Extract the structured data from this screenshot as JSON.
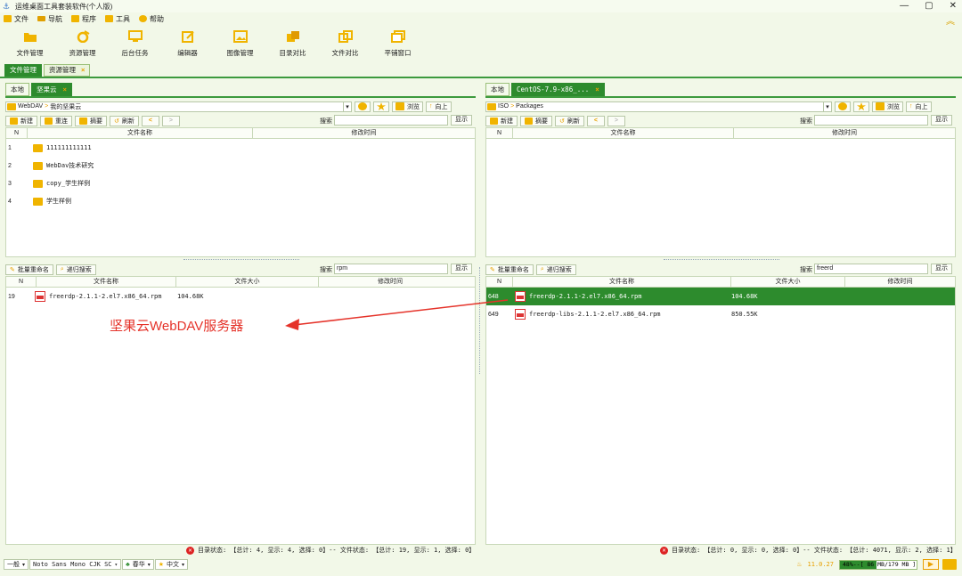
{
  "window": {
    "title": "运维桌面工具套装软件(个人版)",
    "controls": [
      "—",
      "▢",
      "✕"
    ]
  },
  "menu": [
    {
      "label": "文件",
      "color": "#f0b400"
    },
    {
      "label": "导航",
      "color": "#f0b400"
    },
    {
      "label": "程序",
      "color": "#f0b400"
    },
    {
      "label": "工具",
      "color": "#f0b400"
    },
    {
      "label": "帮助",
      "color": "#f0b400"
    }
  ],
  "toolbar": [
    {
      "label": "文件管理",
      "icon": "folder-open-icon"
    },
    {
      "label": "资源管理",
      "icon": "resources-icon"
    },
    {
      "label": "后台任务",
      "icon": "monitor-icon"
    },
    {
      "label": "编辑器",
      "icon": "edit-icon"
    },
    {
      "label": "图像管理",
      "icon": "image-icon"
    },
    {
      "label": "目录对比",
      "icon": "dir-compare-icon"
    },
    {
      "label": "文件对比",
      "icon": "file-compare-icon"
    },
    {
      "label": "平铺窗口",
      "icon": "tile-window-icon"
    }
  ],
  "top_tabs": [
    {
      "label": "文件管理",
      "active": true
    },
    {
      "label": "资源管理",
      "active": false,
      "close": "×"
    }
  ],
  "left": {
    "tabs": [
      {
        "label": "本地"
      },
      {
        "label": "坚果云",
        "close": "×"
      }
    ],
    "path_root": "WebDAV",
    "path_sub": "我的坚果云",
    "browse": "浏览",
    "up": "向上",
    "actions": {
      "new": "新建",
      "reconnect": "重连",
      "summary": "摘要",
      "refresh": "刷新"
    },
    "search_label": "搜索",
    "search_value": "",
    "show": "显示",
    "head": {
      "n": "N",
      "name": "文件名称",
      "mtime": "修改时间"
    },
    "rows": [
      {
        "n": "1",
        "name": "111111111111"
      },
      {
        "n": "2",
        "name": "WebDav技术研究"
      },
      {
        "n": "3",
        "name": "copy_学生样例"
      },
      {
        "n": "4",
        "name": "学生样例"
      }
    ],
    "lower": {
      "batch_rename": "批量重命名",
      "deep_search": "递归搜索",
      "search_label": "搜索",
      "search_value": "rpm",
      "show": "显示",
      "head": {
        "n": "N",
        "name": "文件名称",
        "size": "文件大小",
        "mtime": "修改时间"
      },
      "rows": [
        {
          "n": "19",
          "name": "freerdp-2.1.1-2.el7.x86_64.rpm",
          "size": "104.68K",
          "mtime": ""
        }
      ]
    },
    "status": "目录状态: 【总计: 4, 显示: 4, 选择: 0】-- 文件状态: 【总计: 19, 显示: 1, 选择: 0】"
  },
  "right": {
    "tabs": [
      {
        "label": "本地"
      },
      {
        "label": "CentOS-7.9-x86_...",
        "close": "×"
      }
    ],
    "path_root": "ISO",
    "path_sub": "Packages",
    "browse": "浏览",
    "up": "向上",
    "actions": {
      "new": "新建",
      "summary": "摘要",
      "refresh": "刷新"
    },
    "search_label": "搜索",
    "search_value": "",
    "show": "显示",
    "head": {
      "n": "N",
      "name": "文件名称",
      "mtime": "修改时间"
    },
    "lower": {
      "batch_rename": "批量重命名",
      "deep_search": "递归搜索",
      "search_label": "搜索",
      "search_value": "freerd",
      "show": "显示",
      "head": {
        "n": "N",
        "name": "文件名称",
        "size": "文件大小",
        "mtime": "修改时间"
      },
      "rows": [
        {
          "n": "648",
          "name": "freerdp-2.1.1-2.el7.x86_64.rpm",
          "size": "104.68K",
          "mtime": "",
          "selected": true
        },
        {
          "n": "649",
          "name": "freerdp-libs-2.1.1-2.el7.x86_64.rpm",
          "size": "850.55K",
          "mtime": "",
          "selected": false
        }
      ]
    },
    "status": "目录状态: 【总计: 0, 显示: 0, 选择: 0】-- 文件状态: 【总计: 4071, 显示: 2, 选择: 1】"
  },
  "annotation": "坚果云WebDAV服务器",
  "bottom": {
    "mode": "一般",
    "font": "Noto Sans Mono CJK SC",
    "theme": "春华",
    "lang": "中文",
    "mem_value": "11.0.27",
    "mem_bar": "48%--[ 86 MB/179 MB ]",
    "mem_fraction": 0.48
  },
  "colors": {
    "accent": "#2d8b2d",
    "highlight": "#f0b400",
    "annotation": "#e5332a"
  }
}
